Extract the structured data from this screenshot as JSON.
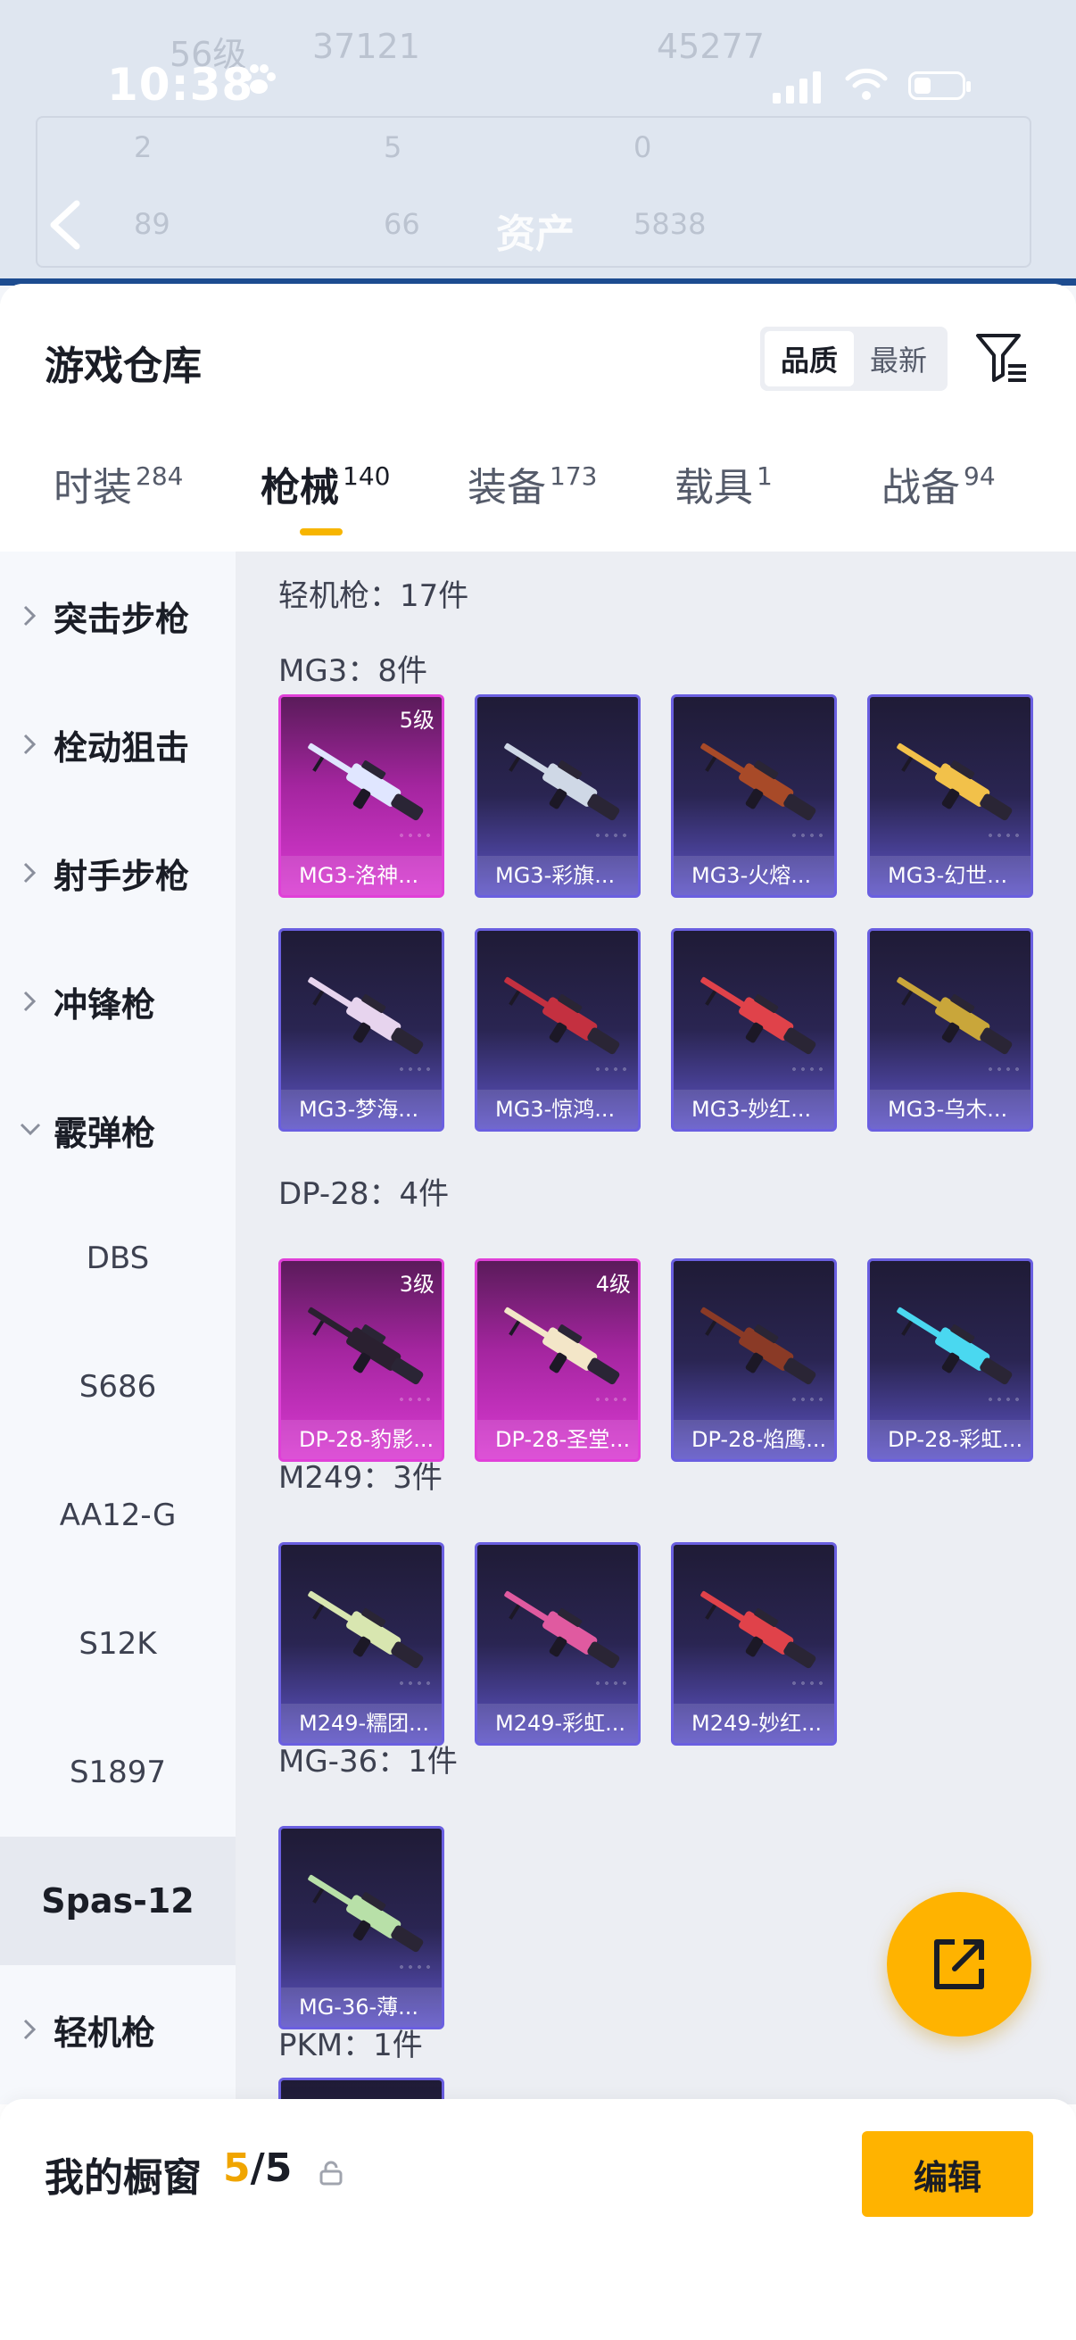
{
  "status_bar": {
    "time": "10:38"
  },
  "backdrop": {
    "assets_title": "资产",
    "faded_level": "56级",
    "faded_num1": "37121",
    "faded_num2": "45277",
    "faded_row1": [
      "2",
      "5",
      "0"
    ],
    "faded_row2": [
      "89",
      "66",
      "5838"
    ]
  },
  "header": {
    "title": "游戏仓库",
    "sort_options": [
      "品质",
      "最新"
    ],
    "active_sort": "品质"
  },
  "tabs": [
    {
      "label": "时装",
      "count": "284"
    },
    {
      "label": "枪械",
      "count": "140"
    },
    {
      "label": "装备",
      "count": "173"
    },
    {
      "label": "载具",
      "count": "1"
    },
    {
      "label": "战备",
      "count": "94"
    }
  ],
  "sidebar": {
    "categories": [
      "突击步枪",
      "栓动狙击",
      "射手步枪",
      "冲锋枪",
      "霰弹枪"
    ],
    "sub_items": [
      "DBS",
      "S686",
      "AA12-G",
      "S12K",
      "S1897",
      "Spas-12"
    ],
    "last_category": "轻机枪"
  },
  "content": {
    "summary": "轻机枪：17件",
    "sections": [
      {
        "title": "MG3：8件",
        "items": [
          {
            "name": "MG3-洛神...",
            "level": "5级",
            "tier": "legendary",
            "color": "#e0e6ff"
          },
          {
            "name": "MG3-彩旗...",
            "level": "",
            "tier": "epic",
            "color": "#cfd8e6"
          },
          {
            "name": "MG3-火熔...",
            "level": "",
            "tier": "epic",
            "color": "#a84a28"
          },
          {
            "name": "MG3-幻世...",
            "level": "",
            "tier": "epic",
            "color": "#f2c14a"
          },
          {
            "name": "MG3-梦海...",
            "level": "",
            "tier": "epic",
            "color": "#e7d4ee"
          },
          {
            "name": "MG3-惊鸿...",
            "level": "",
            "tier": "epic",
            "color": "#c43040"
          },
          {
            "name": "MG3-妙红...",
            "level": "",
            "tier": "epic",
            "color": "#e0424a"
          },
          {
            "name": "MG3-乌木...",
            "level": "",
            "tier": "epic",
            "color": "#c9a63a"
          }
        ]
      },
      {
        "title": "DP-28：4件",
        "items": [
          {
            "name": "DP-28-豹影...",
            "level": "3级",
            "tier": "legendary",
            "color": "#2a2030"
          },
          {
            "name": "DP-28-圣堂...",
            "level": "4级",
            "tier": "legendary",
            "color": "#f3e6c8"
          },
          {
            "name": "DP-28-焰鹰...",
            "level": "",
            "tier": "epic",
            "color": "#8a3a26"
          },
          {
            "name": "DP-28-彩虹...",
            "level": "",
            "tier": "epic",
            "color": "#4ad8f0"
          }
        ]
      },
      {
        "title": "M249：3件",
        "items": [
          {
            "name": "M249-糯团...",
            "level": "",
            "tier": "epic",
            "color": "#d8e6b0"
          },
          {
            "name": "M249-彩虹...",
            "level": "",
            "tier": "epic",
            "color": "#e05aa0"
          },
          {
            "name": "M249-妙红...",
            "level": "",
            "tier": "epic",
            "color": "#e0424a"
          }
        ]
      },
      {
        "title": "MG-36：1件",
        "items": [
          {
            "name": "MG-36-薄...",
            "level": "",
            "tier": "epic",
            "color": "#b8e0a8"
          }
        ]
      },
      {
        "title": "PKM：1件",
        "items": []
      }
    ]
  },
  "bottom_bar": {
    "label": "我的橱窗",
    "current": "5",
    "separator": "/",
    "total": "5",
    "edit_label": "编辑"
  },
  "colors": {
    "accent": "#ffb300",
    "legendary": "#e040d8",
    "epic": "#6a5fe0"
  }
}
